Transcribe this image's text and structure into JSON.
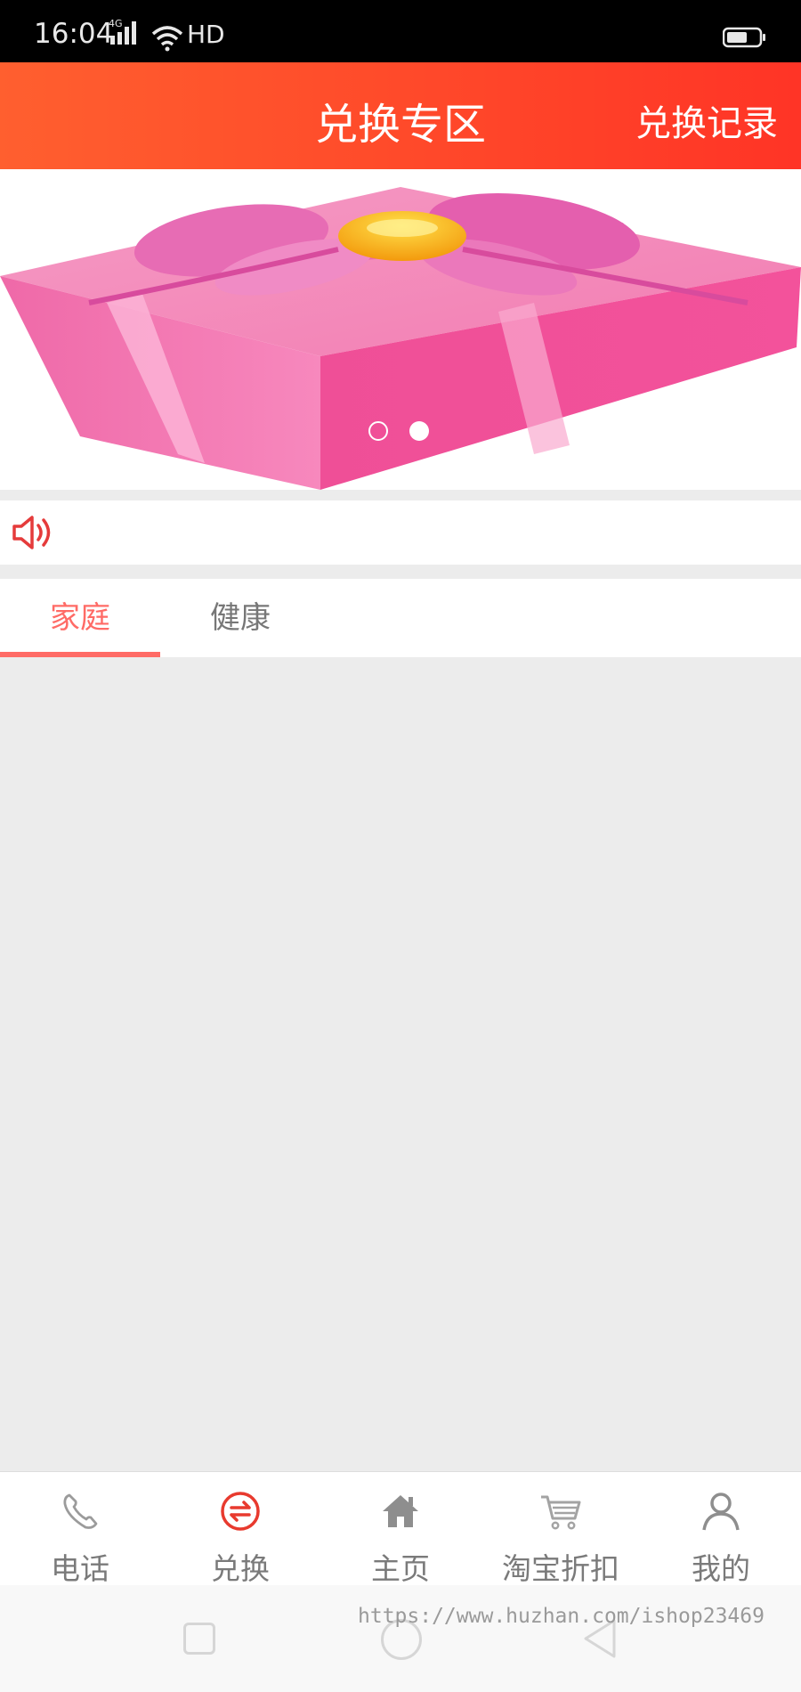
{
  "status_bar": {
    "time": "16:04",
    "hd": "HD",
    "network_icon": "signal-4g-icon",
    "wifi_icon": "wifi-icon",
    "battery_icon": "battery-icon"
  },
  "header": {
    "title": "兑换专区",
    "record_link": "兑换记录",
    "gradient_start": "#ff5f2f",
    "gradient_end": "#ff3426"
  },
  "banner": {
    "image": "pink-gift-box-illustration",
    "slide_count": 2,
    "active_slide": 2
  },
  "notice": {
    "icon": "speaker-icon",
    "text": ""
  },
  "tabs": [
    {
      "label": "家庭",
      "active": true
    },
    {
      "label": "健康",
      "active": false
    }
  ],
  "accent_color": "#ff6b66",
  "bottom_nav": [
    {
      "label": "电话",
      "icon": "phone-icon",
      "active": false
    },
    {
      "label": "兑换",
      "icon": "exchange-icon",
      "active": true
    },
    {
      "label": "主页",
      "icon": "home-icon",
      "active": false
    },
    {
      "label": "淘宝折扣",
      "icon": "cart-icon",
      "active": false
    },
    {
      "label": "我的",
      "icon": "user-icon",
      "active": false
    }
  ],
  "system_nav": {
    "buttons": [
      "recent-apps",
      "home",
      "back"
    ]
  },
  "watermark": "https://www.huzhan.com/ishop23469"
}
